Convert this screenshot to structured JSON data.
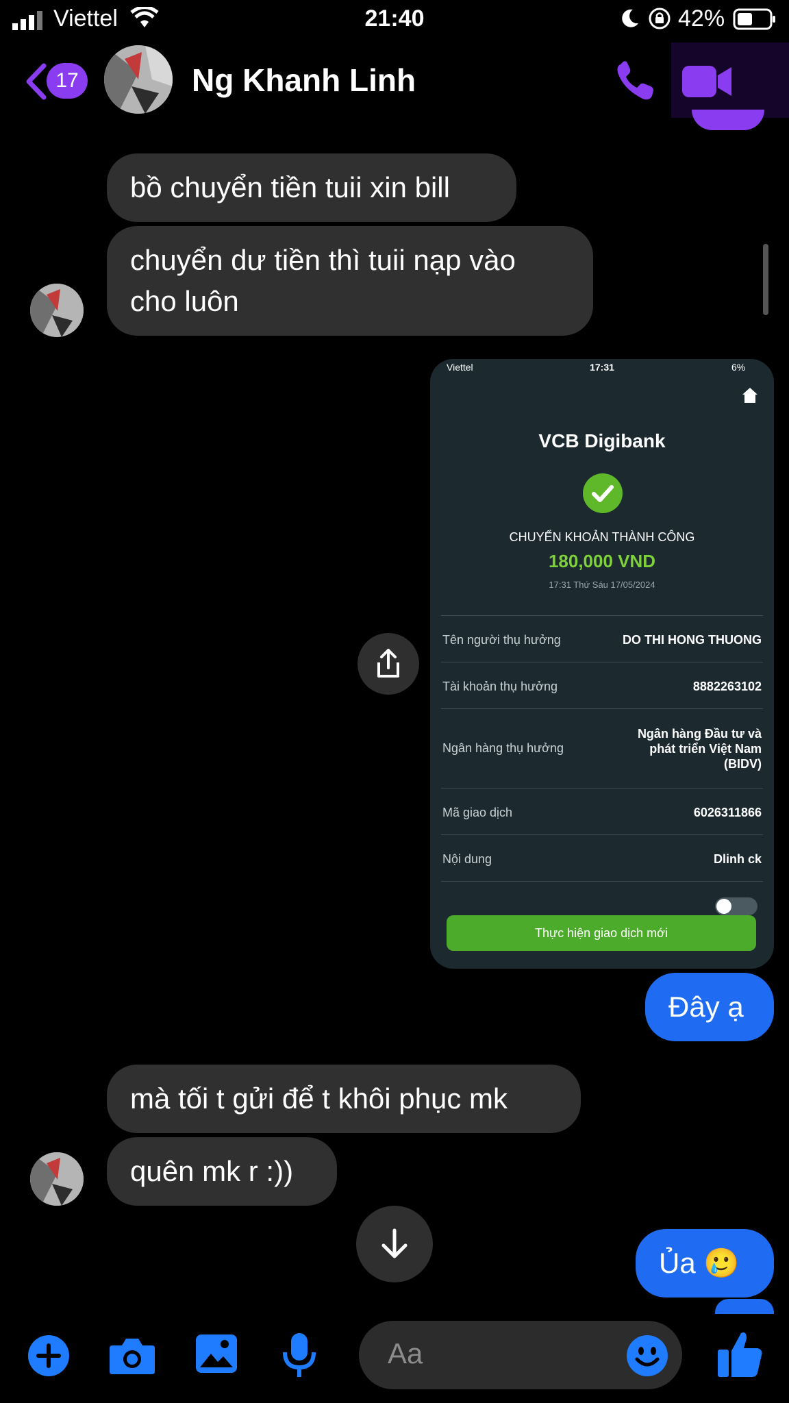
{
  "status_bar": {
    "carrier": "Viettel",
    "time": "21:40",
    "battery": "42%"
  },
  "header": {
    "back_count": "17",
    "contact_name": "Ng Khanh Linh",
    "accent_color": "#8a3df0"
  },
  "messages": [
    {
      "from": "them",
      "text": "bồ chuyển tiền tuii xin bill"
    },
    {
      "from": "them",
      "text": "chuyển dư tiền thì tuii nạp vào cho luôn"
    },
    {
      "from": "me",
      "type": "image"
    },
    {
      "from": "me",
      "text": "Đây ạ"
    },
    {
      "from": "them",
      "text": "mà tối t gửi để t khôi phục mk"
    },
    {
      "from": "them",
      "text": "quên mk r :))"
    },
    {
      "from": "me",
      "text": "Ủa 🥲"
    }
  ],
  "attachment": {
    "status_carrier": "Viettel",
    "status_time": "17:31",
    "status_battery": "6%",
    "brand": "VCB Digibank",
    "result": "CHUYỂN KHOẢN THÀNH CÔNG",
    "amount": "180,000 VND",
    "datetime": "17:31 Thứ Sáu 17/05/2024",
    "rows": [
      {
        "label": "Tên người thụ hưởng",
        "value": "DO THI HONG THUONG"
      },
      {
        "label": "Tài khoản thụ hưởng",
        "value": "8882263102"
      },
      {
        "label": "Ngân hàng thụ hưởng",
        "value": "Ngân hàng Đầu tư và phát triển Việt Nam (BIDV)"
      },
      {
        "label": "Mã giao dịch",
        "value": "6026311866"
      },
      {
        "label": "Nội dung",
        "value": "Dlinh ck"
      }
    ],
    "button": "Thực hiện giao dịch mới",
    "success_color": "#5fb82a"
  },
  "composer": {
    "placeholder": "Aa",
    "icon_color": "#1f7cff"
  }
}
